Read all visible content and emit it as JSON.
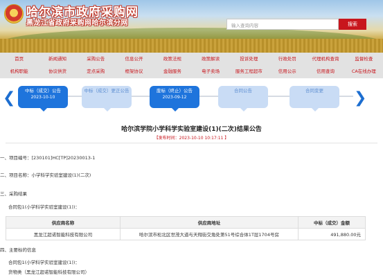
{
  "header": {
    "title": "哈尔滨市政府采购网",
    "subtitle": "黑龙江省政府采购网哈尔滨分网",
    "search_placeholder": "输入查询内容",
    "search_button": "搜索"
  },
  "nav": {
    "row1": [
      "首页",
      "新闻通知",
      "采购公告",
      "信息公开",
      "政策法规",
      "政策解读",
      "投诉处理",
      "行政处罚",
      "代理机构查询",
      "监督检查"
    ],
    "row2": [
      "机构职能",
      "协议供货",
      "定点采购",
      "框架协议",
      "金融服务",
      "电子卖场",
      "服务工程超市",
      "信用公示",
      "信用查询",
      "CA在线办理"
    ]
  },
  "timeline": {
    "prev_icon": "chevron-left-icon",
    "next_icon": "chevron-right-icon",
    "cards": [
      {
        "label": "中标（成交）公告",
        "date": "2023-10-10",
        "state": "active"
      },
      {
        "label": "中标（成交）更正公告",
        "date": "",
        "state": "light"
      },
      {
        "label": "废标（终止）公告",
        "date": "2023-09-12",
        "state": "active"
      },
      {
        "label": "合同公告",
        "date": "",
        "state": "light"
      },
      {
        "label": "合同变更",
        "date": "",
        "state": "light"
      }
    ]
  },
  "document": {
    "title": "哈尔滨学院小学科学实验室建设(1)(二次)结果公告",
    "meta": "【发布时间：2023-10-10 10:17:11 】",
    "section1": "一、项目编号：[230101]HC[TP]20230013-1",
    "section2": "二、项目名称：小学科学实验室建设(1)(二次)",
    "section3": "三、采购结果",
    "package_line": "合同包1(小学科学实验室建设(1))：",
    "table": {
      "headers": [
        "供应商名称",
        "供应商地址",
        "中标（成交）金额"
      ],
      "rows": [
        [
          "黑龙江超诺智能科技有限公司",
          "哈尔滨市松北区世茂大道与天翔街交角处第51号综合体1T层1704号房",
          "491,880.00元"
        ]
      ]
    },
    "section4": "四、主要标的信息",
    "package_line2": "合同包1(小学科学实验室建设(1))：",
    "goods_line": "货物类（黑龙江超诺智能科技有限公司）"
  },
  "colors": {
    "brand_red": "#c8161d",
    "timeline_blue": "#1e74dc",
    "timeline_light": "#c9dcf5"
  }
}
